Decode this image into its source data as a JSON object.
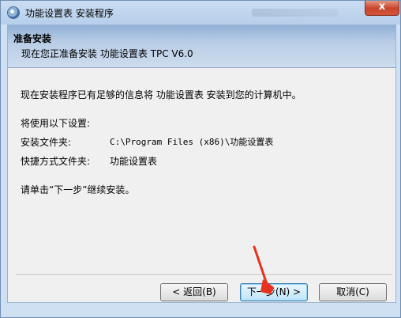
{
  "window": {
    "title": "功能设置表 安装程序",
    "close_label": "x"
  },
  "banner": {
    "title": "准备安装",
    "subtitle": "现在您正准备安装 功能设置表 TPC V6.0"
  },
  "body": {
    "intro": "现在安装程序已有足够的信息将 功能设置表 安装到您的计算机中。",
    "settings_heading": "将使用以下设置:",
    "install_folder_label": "安装文件夹:",
    "install_folder_value": "C:\\Program Files (x86)\\功能设置表",
    "shortcut_folder_label": "快捷方式文件夹:",
    "shortcut_folder_value": "功能设置表",
    "instruction": "请单击“下一步”继续安装。"
  },
  "buttons": {
    "back": "< 返回(B)",
    "next": "下一步(N) >",
    "cancel": "取消(C)"
  },
  "colors": {
    "annotation_arrow": "#e8321e"
  }
}
